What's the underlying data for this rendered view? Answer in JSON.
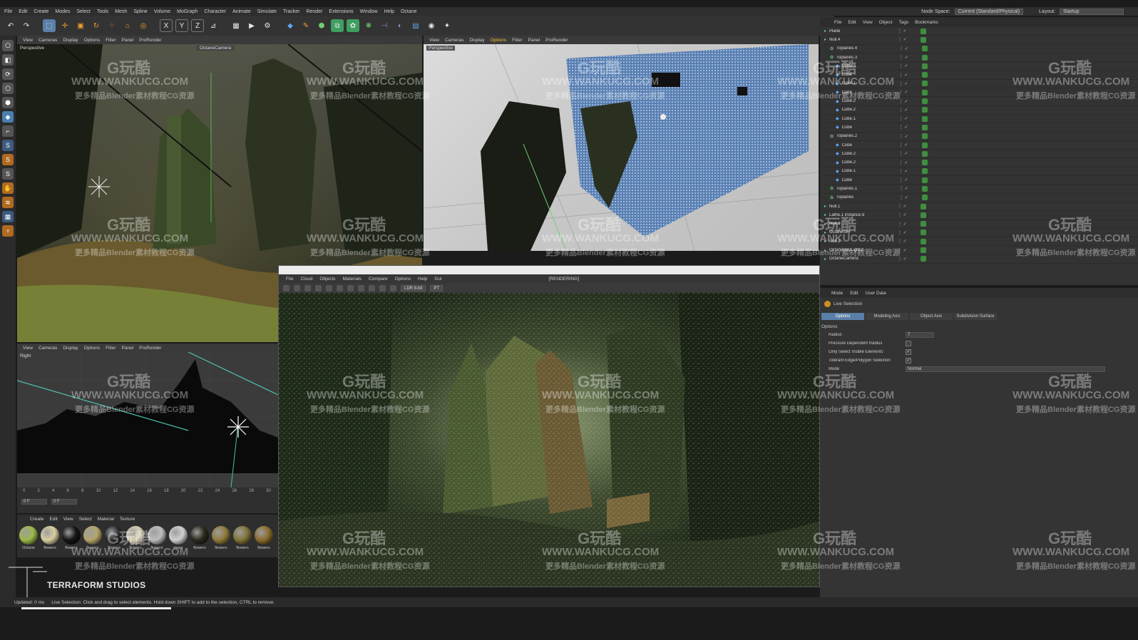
{
  "menubar": {
    "items": [
      "File",
      "Edit",
      "Create",
      "Modes",
      "Select",
      "Tools",
      "Mesh",
      "Spline",
      "Volume",
      "MoGraph",
      "Character",
      "Animate",
      "Simulate",
      "Tracker",
      "Render",
      "Extensions",
      "Window",
      "Help",
      "Octane"
    ],
    "node_space_label": "Node Space:",
    "node_space_value": "Current (Standard/Physical)",
    "layout_label": "Layout:",
    "layout_value": "Startup"
  },
  "viewports": {
    "perspective1": {
      "label": "Perspective",
      "camera": "OctaneCamera",
      "menu": [
        "View",
        "Cameras",
        "Display",
        "Options",
        "Filter",
        "Panel",
        "ProRender"
      ]
    },
    "perspective2": {
      "label": "Perspective",
      "menu": [
        "View",
        "Cameras",
        "Display",
        "Options",
        "Filter",
        "Panel",
        "ProRender"
      ]
    },
    "right": {
      "label": "Right",
      "menu": [
        "View",
        "Cameras",
        "Display",
        "Options",
        "Filter",
        "Panel",
        "ProRender"
      ]
    }
  },
  "timeline": {
    "ticks": [
      "0",
      "2",
      "4",
      "6",
      "8",
      "10",
      "12",
      "14",
      "16",
      "18",
      "20",
      "22",
      "24",
      "26",
      "28",
      "30"
    ],
    "start_frame": "0 F",
    "end_frame": "0 F"
  },
  "material_manager": {
    "menu": [
      "Create",
      "Edit",
      "View",
      "Select",
      "Material",
      "Texture"
    ],
    "materials": [
      {
        "name": "Octane",
        "color": "#9cb84a"
      },
      {
        "name": "flowers",
        "color": "#d8cfa0"
      },
      {
        "name": "flowers",
        "color": "#141414"
      },
      {
        "name": "flowers",
        "color": "#b5a56a"
      },
      {
        "name": "flowers",
        "color": "#2a2a2a"
      },
      {
        "name": "flowers",
        "color": "#d6cdb0"
      },
      {
        "name": "flowers",
        "color": "#bdbdbd"
      },
      {
        "name": "moss",
        "color": "#d0d0d0"
      },
      {
        "name": "flowers",
        "color": "#2b2a1e"
      },
      {
        "name": "flowers",
        "color": "#8f7a3a"
      },
      {
        "name": "flowers",
        "color": "#7f7538"
      },
      {
        "name": "flowers",
        "color": "#8a6d2d"
      }
    ]
  },
  "object_manager": {
    "menu": [
      "File",
      "Edit",
      "View",
      "Object",
      "Tags",
      "Bookmarks"
    ],
    "objects": [
      {
        "name": "Plane",
        "indent": 0
      },
      {
        "name": "Null.4",
        "indent": 0
      },
      {
        "name": "Topiaries.4",
        "indent": 1
      },
      {
        "name": "Topiaries.3",
        "indent": 1
      },
      {
        "name": "Cube.3",
        "indent": 2
      },
      {
        "name": "Cube",
        "indent": 2
      },
      {
        "name": "Cube.1",
        "indent": 2
      },
      {
        "name": "Cube",
        "indent": 2
      },
      {
        "name": "Cube.2",
        "indent": 2
      },
      {
        "name": "Cube.2",
        "indent": 2
      },
      {
        "name": "Cube.1",
        "indent": 2
      },
      {
        "name": "Cube",
        "indent": 2
      },
      {
        "name": "Topiaries.2",
        "indent": 1
      },
      {
        "name": "Cube",
        "indent": 2
      },
      {
        "name": "Cube.2",
        "indent": 2
      },
      {
        "name": "Cube.2",
        "indent": 2
      },
      {
        "name": "Cube.1",
        "indent": 2
      },
      {
        "name": "Cube",
        "indent": 2
      },
      {
        "name": "Topiaries.1",
        "indent": 1
      },
      {
        "name": "Topiaries",
        "indent": 1
      },
      {
        "name": "Null.1",
        "indent": 0
      },
      {
        "name": "Lathe.1 Instance.9",
        "indent": 0
      },
      {
        "name": "Null.2",
        "indent": 0
      },
      {
        "name": "OctaneSky",
        "indent": 0
      },
      {
        "name": "Null.3",
        "indent": 0
      },
      {
        "name": "OctaneDayLight.2",
        "indent": 0
      },
      {
        "name": "OctaneCamera",
        "indent": 0
      }
    ]
  },
  "attribute_manager": {
    "menu": [
      "Mode",
      "Edit",
      "User Data"
    ],
    "tool_name": "Live Selection",
    "tabs": [
      "Options",
      "Modeling Axis",
      "Object Axis",
      "Subdivision Surface"
    ],
    "section": "Options",
    "radius_label": "Radius",
    "radius_value": "7",
    "pressure_label": "Pressure Dependent Radius",
    "only_visible_label": "Only Select Visible Elements",
    "tolerant_label": "Tolerant Edge/Polygon Selection",
    "mode_label": "Mode",
    "mode_value": "Normal"
  },
  "render_window": {
    "menu": [
      "File",
      "Cloud",
      "Objects",
      "Materials",
      "Compare",
      "Options",
      "Help",
      "Gui"
    ],
    "status": "[RENDERING]",
    "color_mode": "LDR 8-bit",
    "pass": "PT"
  },
  "statusbar": {
    "left": "Updated: 0 ms",
    "hint": "Live Selection: Click and drag to select elements. Hold down SHIFT to add to the selection, CTRL to remove."
  },
  "studio_logo": "TERRAFORM STUDIOS",
  "watermark": {
    "logo": "G玩酷",
    "url": "WWW.WANKUCG.COM",
    "sub": "更多精品Blender素材教程CG资源"
  }
}
